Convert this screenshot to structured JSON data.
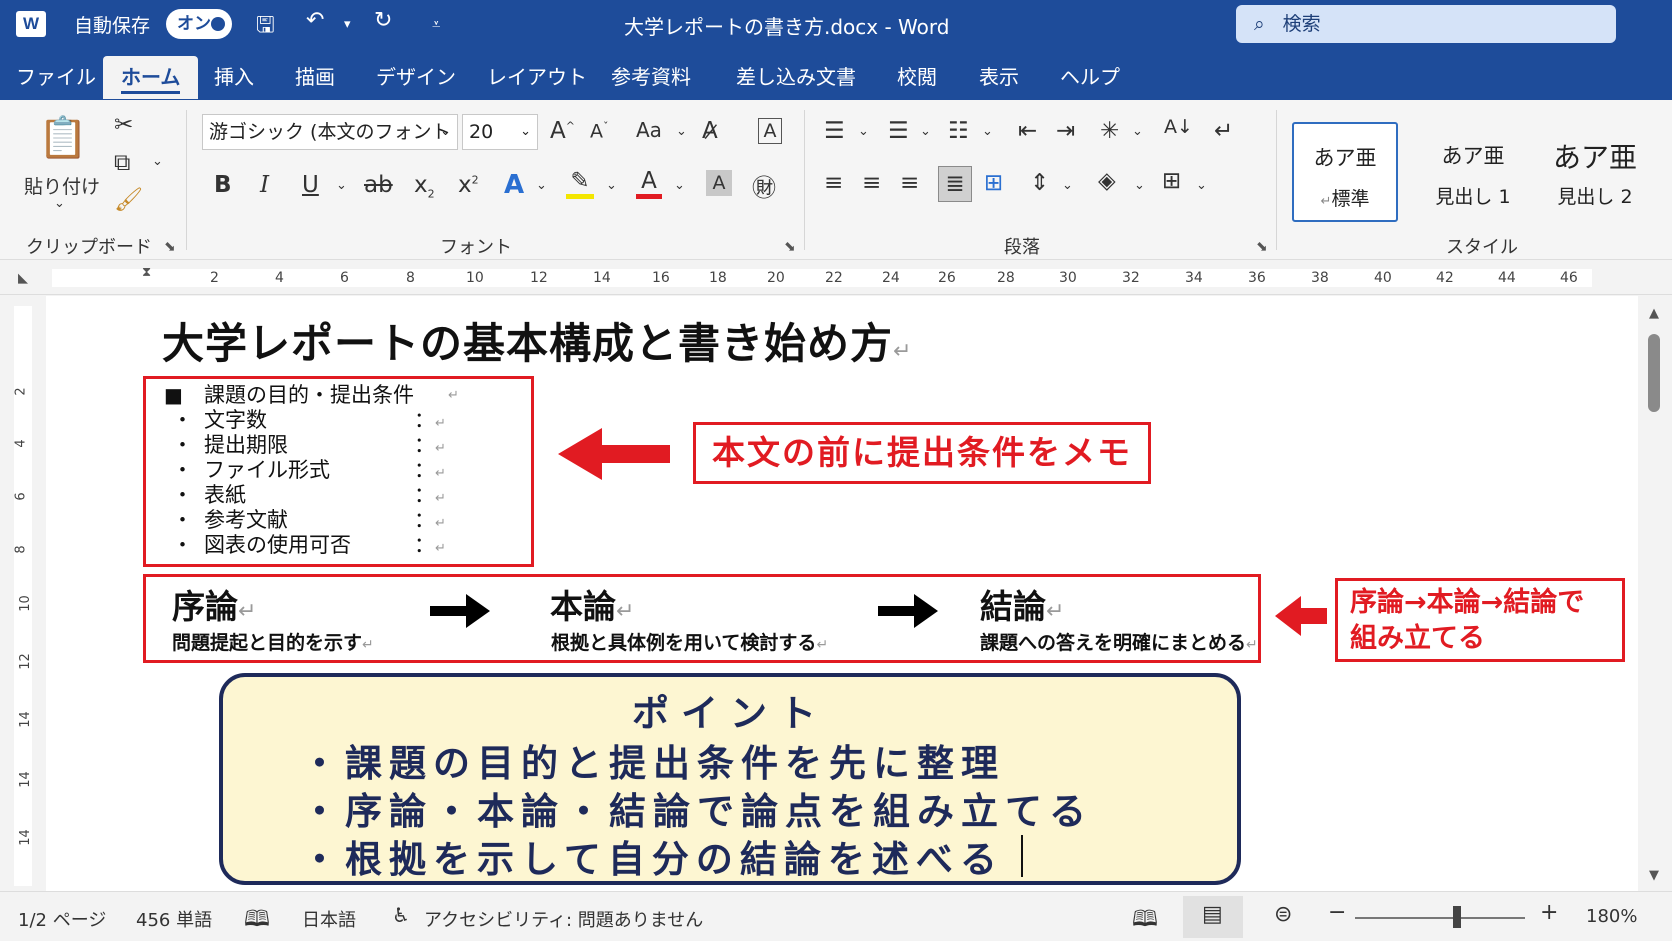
{
  "titlebar": {
    "app_icon": "W",
    "autosave_label": "自動保存",
    "autosave_state": "オン",
    "doc_title": "大学レポートの書き方.docx  -  Word",
    "search_placeholder": "検索",
    "accent": "#1e4c9a"
  },
  "tabs": [
    "ファイル",
    "ホーム",
    "挿入",
    "描画",
    "デザイン",
    "レイアウト",
    "参考資料",
    "差し込み文書",
    "校閲",
    "表示",
    "ヘルプ"
  ],
  "ribbon": {
    "clipboard": {
      "paste": "貼り付け",
      "label": "クリップボード"
    },
    "font": {
      "name": "游ゴシック (本文のフォント",
      "size": "20",
      "case_label": "Aa",
      "label": "フォント"
    },
    "paragraph": {
      "label": "段落"
    },
    "styles": {
      "label": "スタイル",
      "items": [
        {
          "preview": "あア亜",
          "name": "標準"
        },
        {
          "preview": "あア亜",
          "name": "見出し 1"
        },
        {
          "preview": "あア亜",
          "name": "見出し 2"
        }
      ]
    }
  },
  "ruler": {
    "h": [
      "2",
      "4",
      "6",
      "8",
      "10",
      "12",
      "14",
      "16",
      "18",
      "20",
      "22",
      "24",
      "26",
      "28",
      "30",
      "32",
      "34",
      "36",
      "38",
      "40",
      "42",
      "44",
      "46"
    ],
    "v": [
      "2",
      "4",
      "6",
      "8",
      "10",
      "12",
      "14",
      "14",
      "14"
    ]
  },
  "document": {
    "title": "大学レポートの基本構成と書き始め方",
    "conditions_head": "課題の目的・提出条件",
    "conditions": [
      "文字数",
      "提出期限",
      "ファイル形式",
      "表紙",
      "参考文献",
      "図表の使用可否"
    ],
    "memo_note": "本文の前に提出条件をメモ",
    "flow": [
      {
        "head": "序論",
        "sub": "問題提起と目的を示す"
      },
      {
        "head": "本論",
        "sub": "根拠と具体例を用いて検討する"
      },
      {
        "head": "結論",
        "sub": "課題への答えを明確にまとめる"
      }
    ],
    "flow_note_1": "序論→本論→結論で",
    "flow_note_2": "組み立てる",
    "point_title": "ポイント",
    "points": [
      "・課題の目的と提出条件を先に整理",
      "・序論・本論・結論で論点を組み立てる",
      "・根拠を示して自分の結論を述べる"
    ]
  },
  "status": {
    "page": "1/2 ページ",
    "words": "456 単語",
    "language": "日本語",
    "accessibility": "アクセシビリティ: 問題ありません",
    "zoom": "180%",
    "zoom_level_percent": 180
  }
}
